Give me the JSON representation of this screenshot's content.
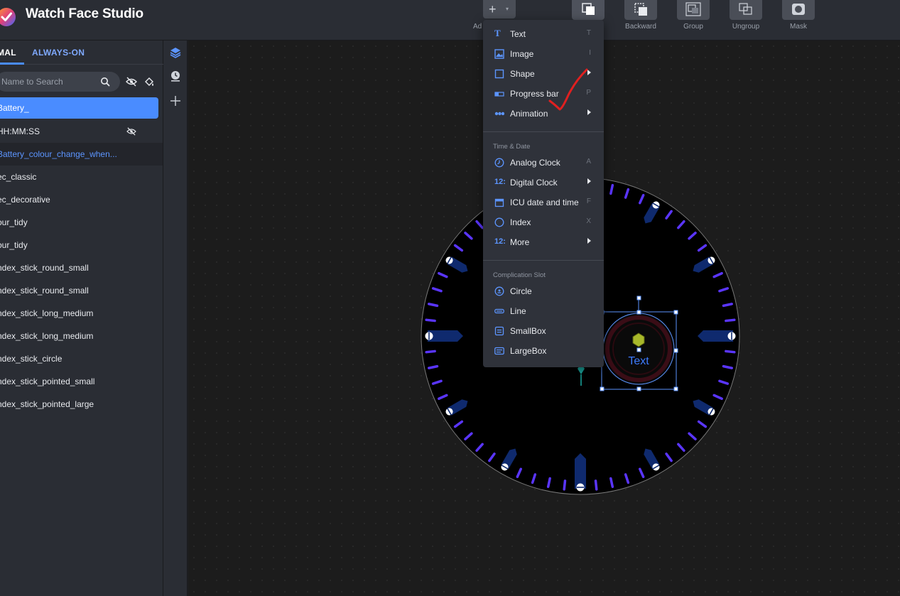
{
  "app": {
    "title": "Watch Face Studio"
  },
  "toolbar": {
    "add_label": "Ad",
    "backward_label": "Backward",
    "group_label": "Group",
    "ungroup_label": "Ungroup",
    "mask_label": "Mask"
  },
  "tabs": {
    "normal": "MAL",
    "always_on": "ALWAYS-ON"
  },
  "search": {
    "placeholder": "Name to Search"
  },
  "layers": [
    {
      "label": "Battery_"
    },
    {
      "label": "HH:MM:SS"
    },
    {
      "label": "Battery_colour_change_when..."
    },
    {
      "label": "ec_classic"
    },
    {
      "label": "ec_decorative"
    },
    {
      "label": "our_tidy"
    },
    {
      "label": "our_tidy"
    },
    {
      "label": "ndex_stick_round_small"
    },
    {
      "label": "ndex_stick_round_small"
    },
    {
      "label": "ndex_stick_long_medium"
    },
    {
      "label": "ndex_stick_long_medium"
    },
    {
      "label": "ndex_stick_circle"
    },
    {
      "label": "ndex_stick_pointed_small"
    },
    {
      "label": "ndex_stick_pointed_large"
    }
  ],
  "menu": {
    "items": [
      {
        "label": "Text",
        "key": "T"
      },
      {
        "label": "Image",
        "key": "I"
      },
      {
        "label": "Shape",
        "key": ""
      },
      {
        "label": "Progress bar",
        "key": "P"
      },
      {
        "label": "Animation",
        "key": ""
      }
    ],
    "time_date_header": "Time & Date",
    "time_date": [
      {
        "label": "Analog Clock",
        "key": "A"
      },
      {
        "label": "Digital Clock",
        "key": ""
      },
      {
        "label": "ICU date and time",
        "key": "F"
      },
      {
        "label": "Index",
        "key": "X"
      },
      {
        "label": "More",
        "key": ""
      }
    ],
    "complication_header": "Complication Slot",
    "complication": [
      {
        "label": "Circle"
      },
      {
        "label": "Line"
      },
      {
        "label": "SmallBox"
      },
      {
        "label": "LargeBox"
      }
    ],
    "num_icon": "12:"
  },
  "canvas": {
    "complication_text": "Text"
  },
  "colors": {
    "accent": "#4a8cff",
    "tick": "#5a35ff",
    "annotation": "#e02020"
  }
}
